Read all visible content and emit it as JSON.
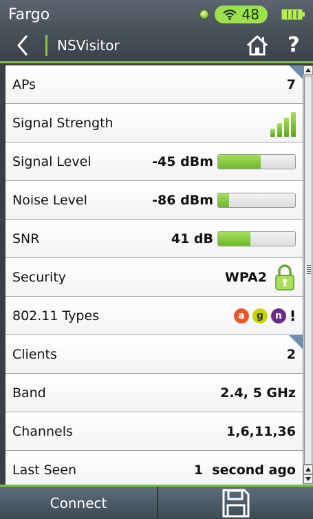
{
  "status": {
    "device_name": "Fargo",
    "wifi_count": "48"
  },
  "titlebar": {
    "title": "NSVisitor",
    "help_label": "?"
  },
  "rows": {
    "aps": {
      "label": "APs",
      "value": "7"
    },
    "signal_strength": {
      "label": "Signal Strength",
      "bars": 4
    },
    "signal_level": {
      "label": "Signal Level",
      "value": "-45 dBm",
      "fill_percent": 55
    },
    "noise_level": {
      "label": "Noise Level",
      "value": "-86 dBm",
      "fill_percent": 14
    },
    "snr": {
      "label": "SNR",
      "value": "41 dB",
      "fill_percent": 42
    },
    "security": {
      "label": "Security",
      "value": "WPA2"
    },
    "types": {
      "label": "802.11 Types",
      "badges": [
        "a",
        "g",
        "n"
      ],
      "warning": "!"
    },
    "clients": {
      "label": "Clients",
      "value": "2"
    },
    "band": {
      "label": "Band",
      "value": "2.4, 5 GHz"
    },
    "channels": {
      "label": "Channels",
      "value": "1,6,11,36"
    },
    "last_seen": {
      "label": "Last Seen",
      "value": "1  second ago"
    }
  },
  "bottom": {
    "connect_label": "Connect"
  },
  "colors": {
    "accent": "#7bc143",
    "badge_a": "#e8562a",
    "badge_g": "#c8d400",
    "badge_n": "#6a2b86"
  }
}
